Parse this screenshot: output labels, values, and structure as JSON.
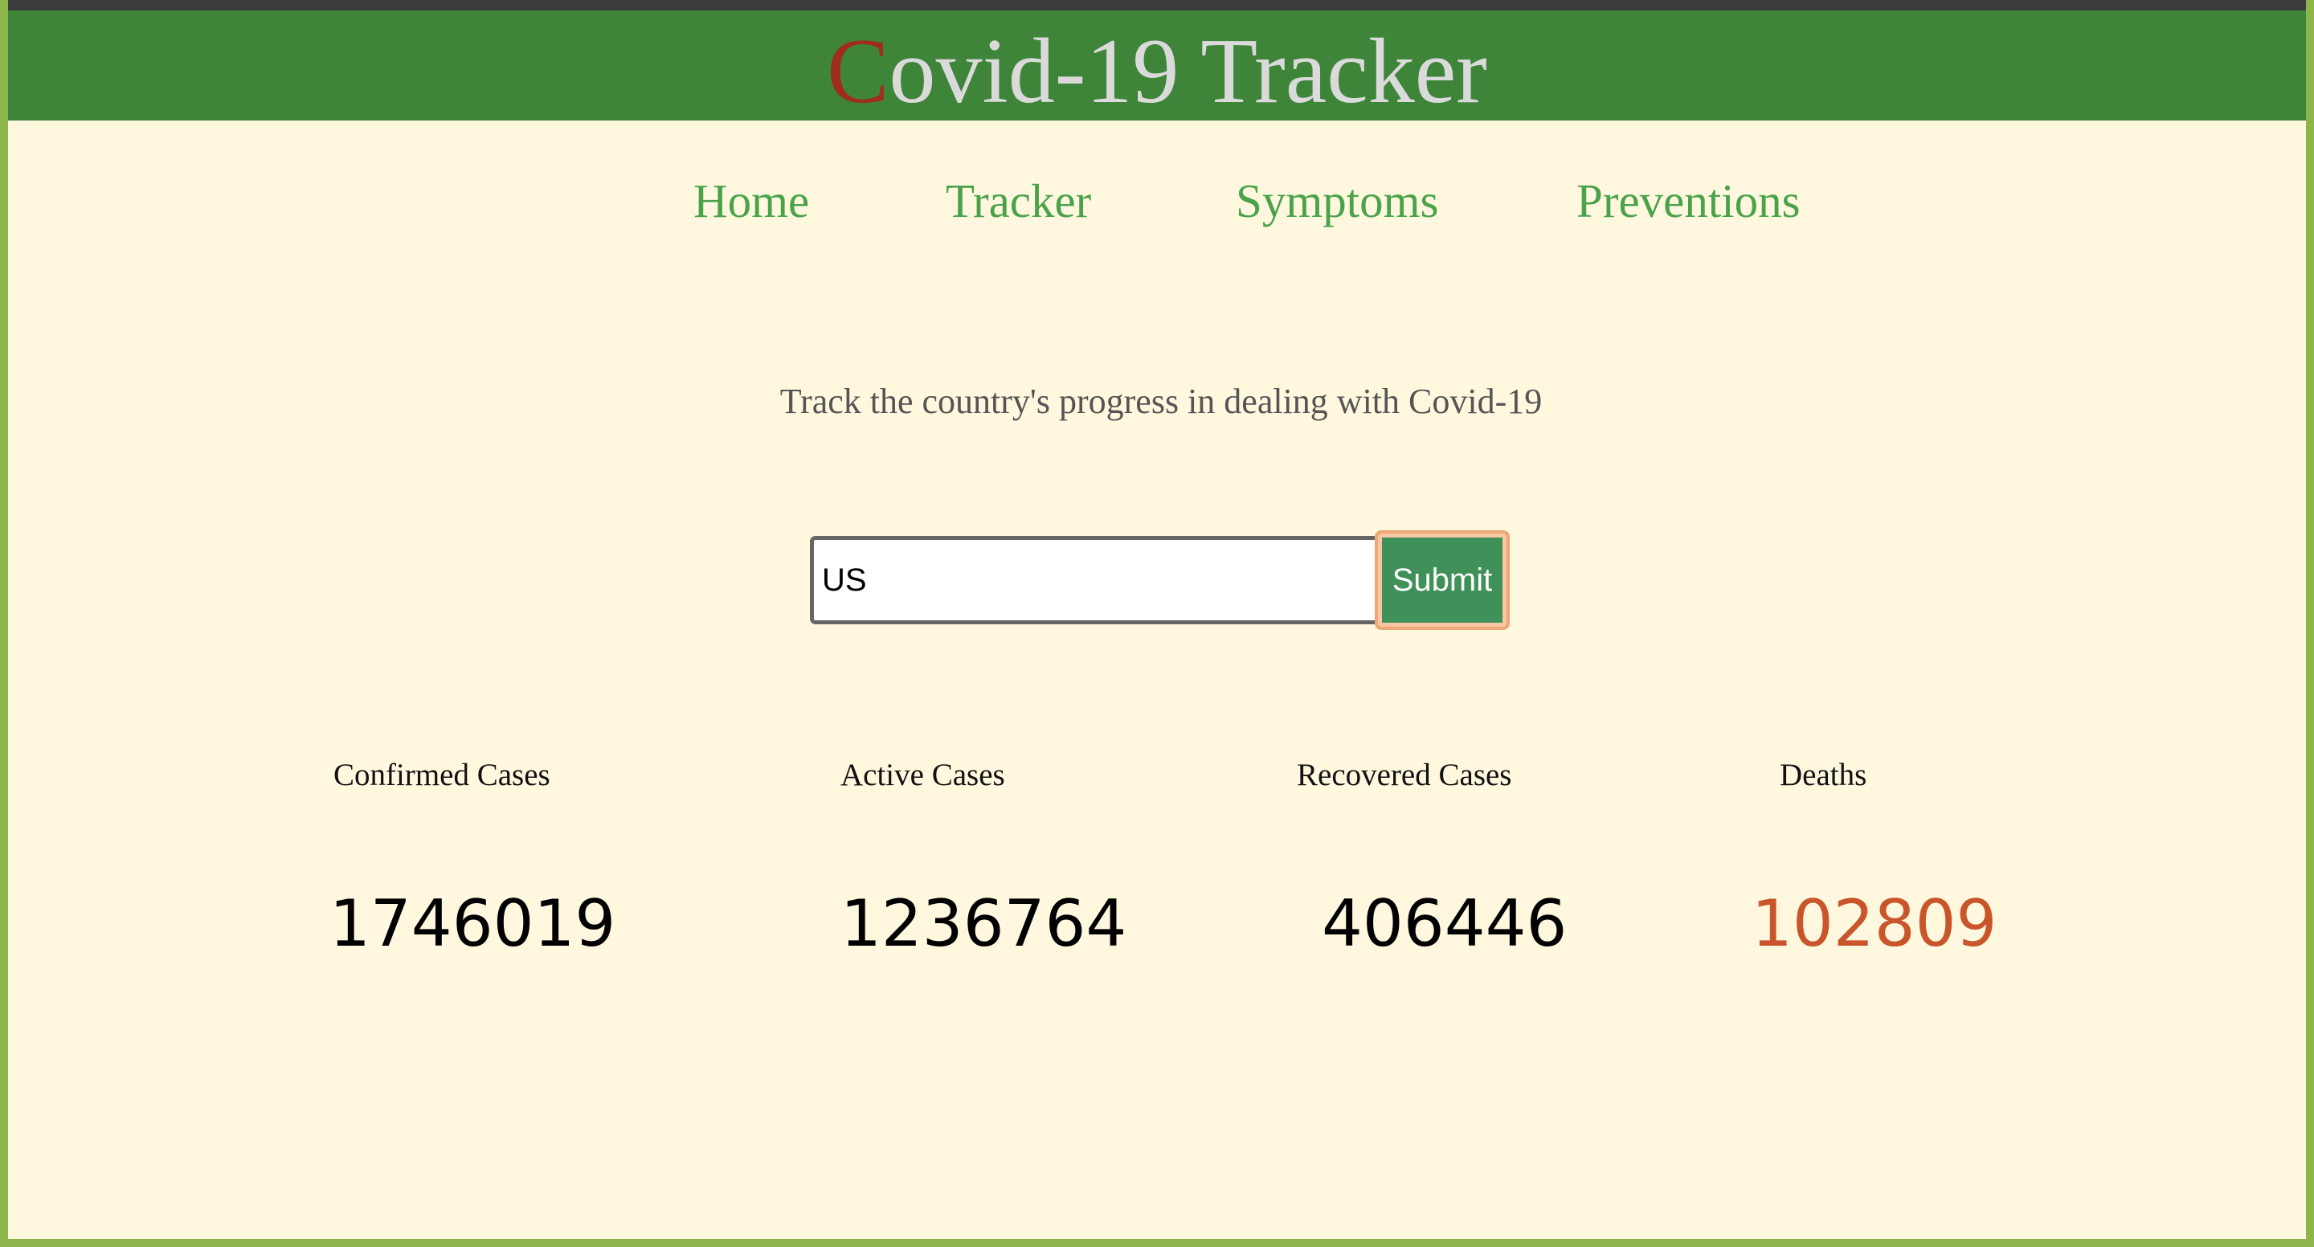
{
  "header": {
    "title_first_letter": "C",
    "title_rest": "ovid-19 Tracker"
  },
  "nav": {
    "items": [
      {
        "label": "Home"
      },
      {
        "label": "Tracker"
      },
      {
        "label": "Symptoms"
      },
      {
        "label": "Preventions"
      }
    ]
  },
  "main": {
    "tagline": "Track the country's progress in dealing with Covid-19",
    "search": {
      "value": "US",
      "submit_label": "Submit"
    },
    "stats": [
      {
        "label": "Confirmed Cases",
        "value": "1746019"
      },
      {
        "label": "Active Cases",
        "value": "1236764"
      },
      {
        "label": "Recovered Cases",
        "value": "406446"
      },
      {
        "label": "Deaths",
        "value": "102809"
      }
    ]
  },
  "colors": {
    "header_bg": "#3E853A",
    "page_bg": "#FFF8DF",
    "nav_link": "#4AA34A",
    "title_accent": "#A12B1F",
    "deaths": "#C9552B",
    "submit_bg": "#3F9159",
    "frame": "#8CB64C"
  }
}
